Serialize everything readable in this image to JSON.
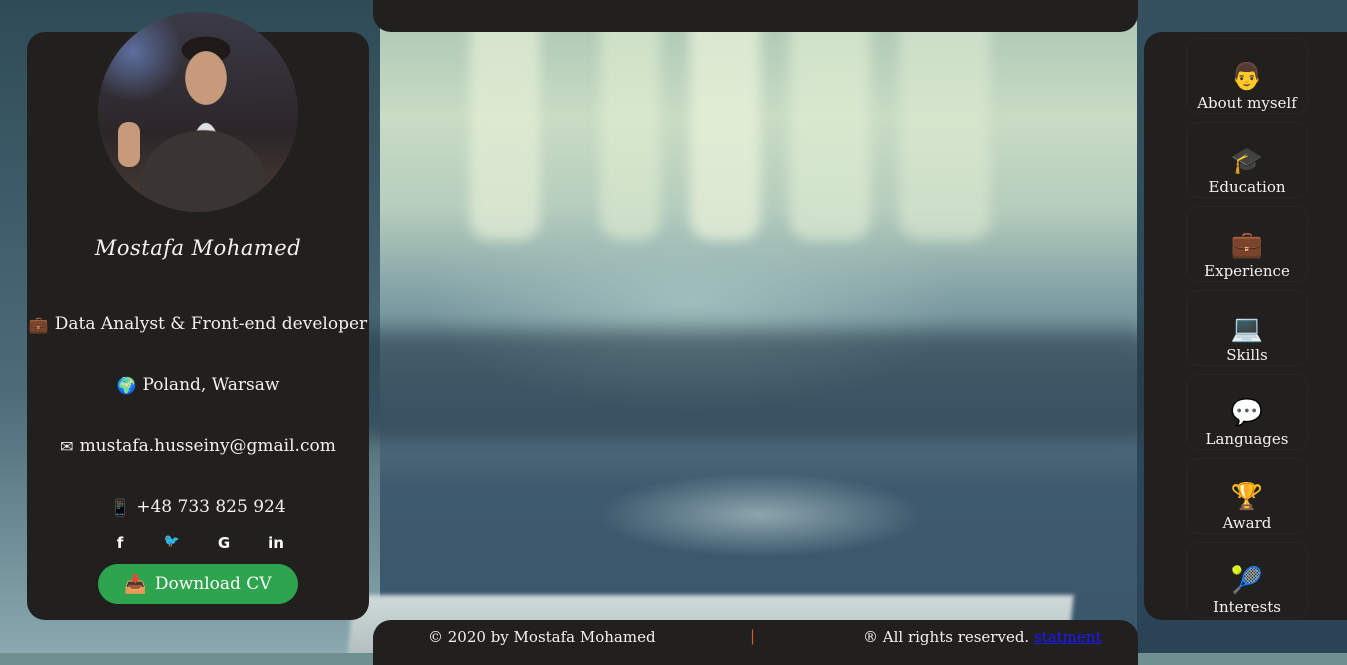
{
  "profile": {
    "name": "Mostafa Mohamed",
    "title": "Data Analyst & Front-end developer",
    "location": "Poland, Warsaw",
    "email": "mustafa.husseiny@gmail.com",
    "phone": "+48 733 825 924",
    "download_label": "Download CV",
    "icons": {
      "title": "💼",
      "location": "🌍",
      "email": "✉",
      "phone": "📱",
      "download": "📥"
    }
  },
  "social": {
    "facebook": "f",
    "twitter": "🐦",
    "google": "G",
    "linkedin": "in"
  },
  "nav": [
    {
      "label": "About myself",
      "icon": "👨"
    },
    {
      "label": "Education",
      "icon": "🎓"
    },
    {
      "label": "Experience",
      "icon": "💼"
    },
    {
      "label": "Skills",
      "icon": "💻"
    },
    {
      "label": "Languages",
      "icon": "💬"
    },
    {
      "label": "Award",
      "icon": "🏆"
    },
    {
      "label": "Interests",
      "icon": "🎾"
    }
  ],
  "footer": {
    "copyright": "© 2020 by Mostafa Mohamed",
    "separator": "|",
    "rights": "® All rights reserved.",
    "link": "statment"
  },
  "colors": {
    "panel": "#221f1f",
    "accent_green": "#2ea44f",
    "separator": "#d85a2a",
    "link": "#1a1aff"
  }
}
